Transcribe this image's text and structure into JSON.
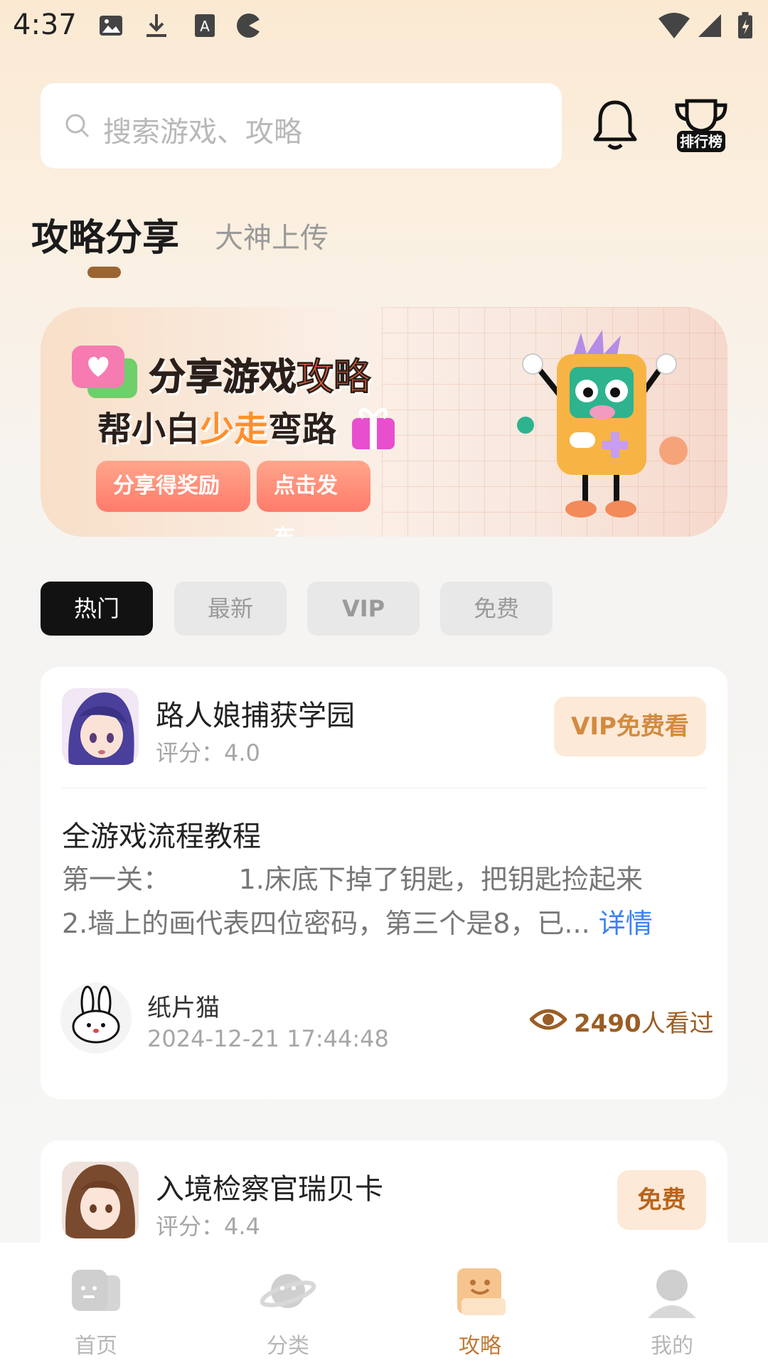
{
  "status_bar": {
    "time": "4:37"
  },
  "search": {
    "placeholder": "搜索游戏、攻略"
  },
  "header": {
    "rank_label": "排行榜"
  },
  "tabs": [
    {
      "label": "攻略分享"
    },
    {
      "label": "大神上传"
    }
  ],
  "banner": {
    "line1_a": "分享游戏",
    "line1_b": "攻略",
    "line2_a": "帮小白",
    "line2_b": "少走",
    "line2_c": "弯路",
    "button1": "分享得奖励",
    "button2": "点击发布"
  },
  "filters": [
    {
      "label": "热门"
    },
    {
      "label": "最新"
    },
    {
      "label": "VIP"
    },
    {
      "label": "免费"
    }
  ],
  "cards": [
    {
      "game_title": "路人娘捕获学园",
      "score": "评分：4.0",
      "badge": "VIP免费看",
      "guide_title": "全游戏流程教程",
      "guide_line1": "第一关：        1.床底下掉了钥匙，把钥匙捡起来",
      "guide_line2": "2.墙上的画代表四位密码，第三个是8，已...",
      "more": "详情",
      "author": "纸片猫",
      "time": "2024-12-21 17:44:48",
      "views_count": "2490",
      "views_suffix": "人看过"
    },
    {
      "game_title": "入境检察官瑞贝卡",
      "score": "评分：4.4",
      "badge": "免费"
    }
  ],
  "bottom_nav": [
    {
      "label": "首页"
    },
    {
      "label": "分类"
    },
    {
      "label": "攻略"
    },
    {
      "label": "我的"
    }
  ],
  "colors": {
    "accent": "#c07a36",
    "link": "#3a82f7",
    "chip_active": "#121212"
  }
}
